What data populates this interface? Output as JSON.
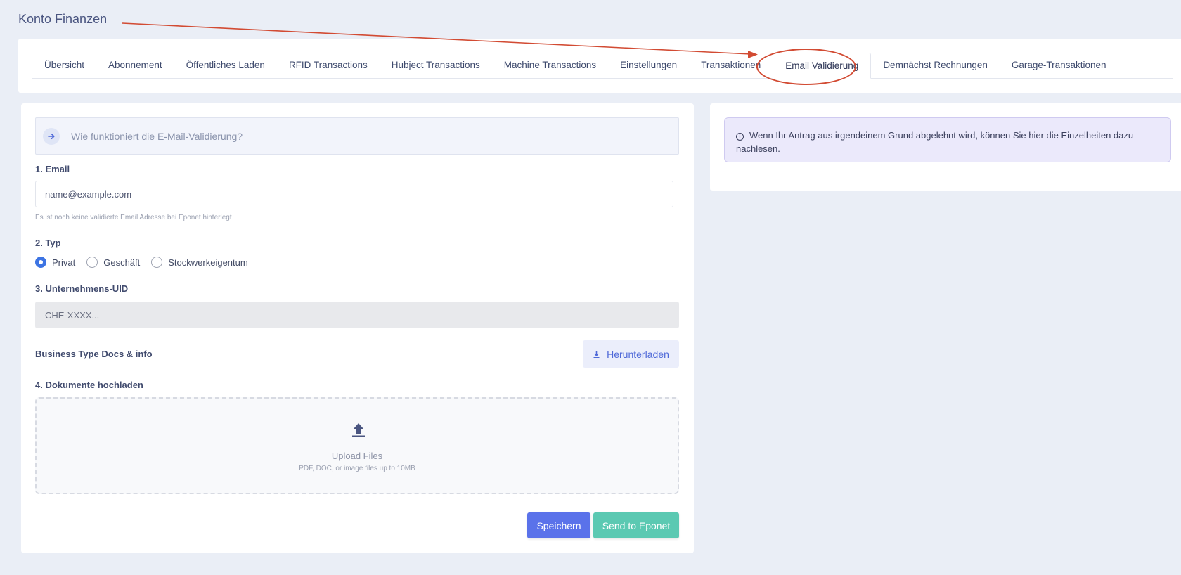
{
  "header": {
    "title": "Konto Finanzen"
  },
  "tabs": [
    {
      "label": "Übersicht"
    },
    {
      "label": "Abonnement"
    },
    {
      "label": "Öffentliches Laden"
    },
    {
      "label": "RFID Transactions"
    },
    {
      "label": "Hubject Transactions"
    },
    {
      "label": "Machine Transactions"
    },
    {
      "label": "Einstellungen"
    },
    {
      "label": "Transaktionen"
    },
    {
      "label": "Email Validierung",
      "active": true
    },
    {
      "label": "Demnächst Rechnungen"
    },
    {
      "label": "Garage-Transaktionen"
    }
  ],
  "form": {
    "info_text": "Wie funktioniert die E-Mail-Validierung?",
    "email": {
      "label": "1. Email",
      "placeholder": "name@example.com",
      "hint": "Es ist noch keine validierte Email Adresse bei Eponet hinterlegt"
    },
    "type": {
      "label": "2. Typ",
      "options": [
        "Privat",
        "Geschäft",
        "Stockwerkeigentum"
      ],
      "selected": "Privat"
    },
    "uid": {
      "label": "3. Unternehmens-UID",
      "placeholder": "CHE-XXXX..."
    },
    "docs": {
      "label": "Business Type Docs & info",
      "download_label": "Herunterladen"
    },
    "upload": {
      "label": "4. Dokumente hochladen",
      "title": "Upload Files",
      "subtitle": "PDF, DOC, or image files up to 10MB"
    },
    "buttons": {
      "save": "Speichern",
      "send": "Send to Eponet"
    }
  },
  "side_panel": {
    "alert_text": "Wenn Ihr Antrag aus irgendeinem Grund abgelehnt wird, können Sie hier die Einzelheiten dazu nachlesen."
  },
  "colors": {
    "background": "#eaeef6",
    "primary": "#5a72ea",
    "teal": "#5bc9b2",
    "annotation": "#d24b33",
    "alert_bg": "#ebe9fb"
  }
}
